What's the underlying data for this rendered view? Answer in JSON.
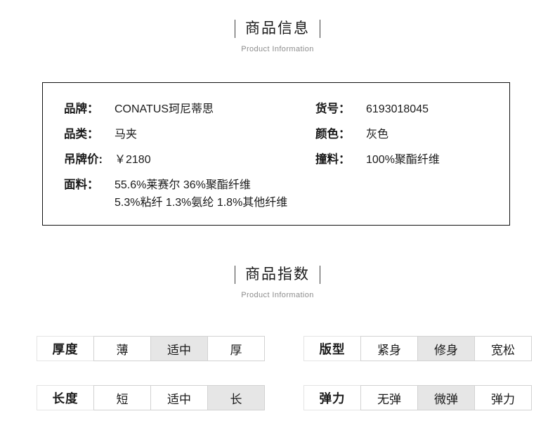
{
  "sections": {
    "info": {
      "title": "商品信息",
      "subtitle": "Product Information"
    },
    "index": {
      "title": "商品指数",
      "subtitle": "Product Information"
    }
  },
  "product_info": {
    "left": [
      {
        "label": "品牌：",
        "value": "CONATUS珂尼蒂思"
      },
      {
        "label": "品类：",
        "value": "马夹"
      },
      {
        "label": "吊牌价:",
        "value": "￥2180"
      }
    ],
    "fabric": {
      "label": "面料：",
      "line1": "55.6%莱赛尔 36%聚酯纤维",
      "line2": "5.3%粘纤 1.3%氨纶 1.8%其他纤维"
    },
    "right": [
      {
        "label": "货号：",
        "value": "6193018045"
      },
      {
        "label": "颜色：",
        "value": "灰色"
      },
      {
        "label": "撞料：",
        "value": "100%聚酯纤维"
      }
    ]
  },
  "product_index": [
    {
      "name": "thickness",
      "header": "厚度",
      "options": [
        "薄",
        "适中",
        "厚"
      ],
      "selected": 1
    },
    {
      "name": "fit",
      "header": "版型",
      "options": [
        "紧身",
        "修身",
        "宽松"
      ],
      "selected": 1
    },
    {
      "name": "length",
      "header": "长度",
      "options": [
        "短",
        "适中",
        "长"
      ],
      "selected": 2
    },
    {
      "name": "elasticity",
      "header": "弹力",
      "options": [
        "无弹",
        "微弹",
        "弹力"
      ],
      "selected": 1
    }
  ],
  "colors": {
    "text": "#1a1a1a",
    "subtitle": "#8c8c8c",
    "box_border": "#111111",
    "cell_border": "#d2d2d2",
    "cell_active_bg": "#e6e6e6"
  }
}
